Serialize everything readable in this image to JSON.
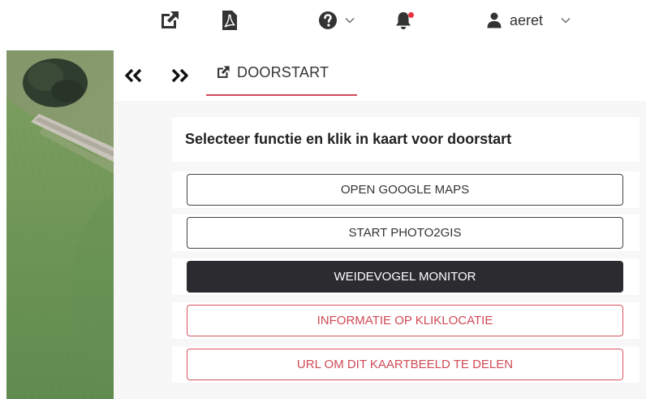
{
  "toolbar": {
    "username": "aeret",
    "notification_dot_color": "#e8313f"
  },
  "panel": {
    "tab_label": "DOORSTART",
    "tab_underline_color": "#d4495a",
    "heading": "Selecteer functie en klik in kaart voor doorstart",
    "buttons": [
      {
        "label": "OPEN GOOGLE MAPS",
        "style": "default"
      },
      {
        "label": "START PHOTO2GIS",
        "style": "default"
      },
      {
        "label": "WEIDEVOGEL MONITOR",
        "style": "active-dark"
      },
      {
        "label": "INFORMATIE OP KLIKLOCATIE",
        "style": "red-outline"
      },
      {
        "label": "URL OM DIT KAARTBEELD TE DELEN",
        "style": "red-outline"
      }
    ]
  },
  "colors": {
    "dark_button": "#2c2c30",
    "red_accent": "#d95560"
  }
}
